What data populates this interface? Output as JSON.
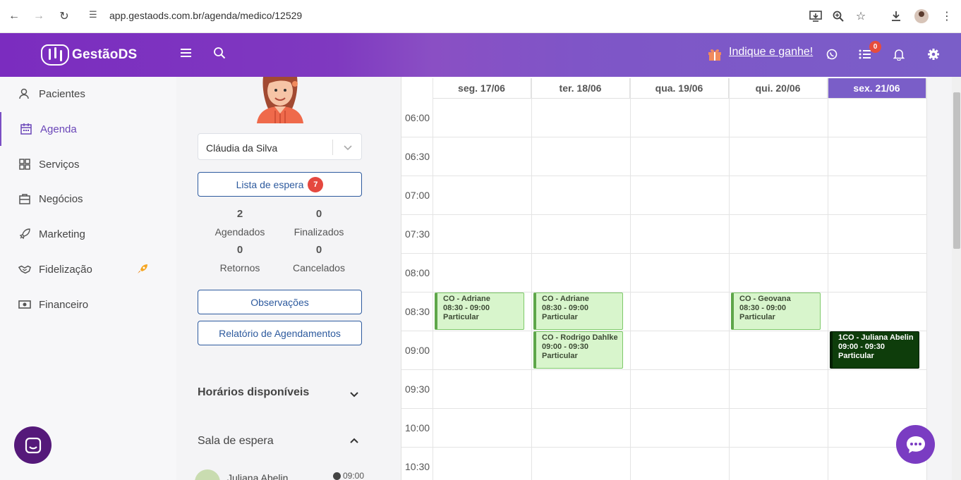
{
  "browser": {
    "url": "app.gestaods.com.br/agenda/medico/12529"
  },
  "header": {
    "logo_text": "GestãoDS",
    "indique_label": "Indique e ganhe!",
    "notification_count": "0"
  },
  "sidebar": {
    "items": [
      {
        "label": "Pacientes",
        "icon": "users-icon"
      },
      {
        "label": "Agenda",
        "icon": "calendar-icon"
      },
      {
        "label": "Serviços",
        "icon": "grid-icon"
      },
      {
        "label": "Negócios",
        "icon": "briefcase-icon"
      },
      {
        "label": "Marketing",
        "icon": "rocket-icon"
      },
      {
        "label": "Fidelização",
        "icon": "handshake-icon"
      },
      {
        "label": "Financeiro",
        "icon": "money-icon"
      }
    ]
  },
  "doctor": {
    "selected": "Cláudia da Silva"
  },
  "waitlist": {
    "label": "Lista de espera",
    "count": "7"
  },
  "stats": {
    "agendados_value": "2",
    "agendados_label": "Agendados",
    "finalizados_value": "0",
    "finalizados_label": "Finalizados",
    "retornos_value": "0",
    "retornos_label": "Retornos",
    "cancelados_value": "0",
    "cancelados_label": "Cancelados"
  },
  "buttons": {
    "observacoes": "Observações",
    "relatorio": "Relatório de Agendamentos"
  },
  "sections": {
    "horarios": "Horários disponíveis",
    "sala": "Sala de espera"
  },
  "sala_espera": {
    "patient_name": "Juliana Abelin",
    "time": "09:00"
  },
  "calendar": {
    "days": [
      "seg. 17/06",
      "ter. 18/06",
      "qua. 19/06",
      "qui. 20/06",
      "sex. 21/06"
    ],
    "times": [
      "06:00",
      "06:30",
      "07:00",
      "07:30",
      "08:00",
      "08:30",
      "09:00",
      "09:30",
      "10:00",
      "10:30"
    ],
    "appointments": [
      {
        "title": "CO - Adriane",
        "time": "08:30 - 09:00",
        "type": "Particular"
      },
      {
        "title": "CO - Adriane",
        "time": "08:30 - 09:00",
        "type": "Particular"
      },
      {
        "title": "CO - Rodrigo Dahlke",
        "time": "09:00 - 09:30",
        "type": "Particular"
      },
      {
        "title": "CO - Geovana",
        "time": "08:30 - 09:00",
        "type": "Particular"
      },
      {
        "title": "1CO - Juliana Abelin",
        "time": "09:00 - 09:30",
        "type": "Particular"
      }
    ]
  },
  "colors": {
    "brand": "#7b2cbf",
    "today_header": "#7a5ec8",
    "appt_bg": "#d8f5cc",
    "appt_dark": "#0e3d0b",
    "link_blue": "#2d5a9e"
  }
}
